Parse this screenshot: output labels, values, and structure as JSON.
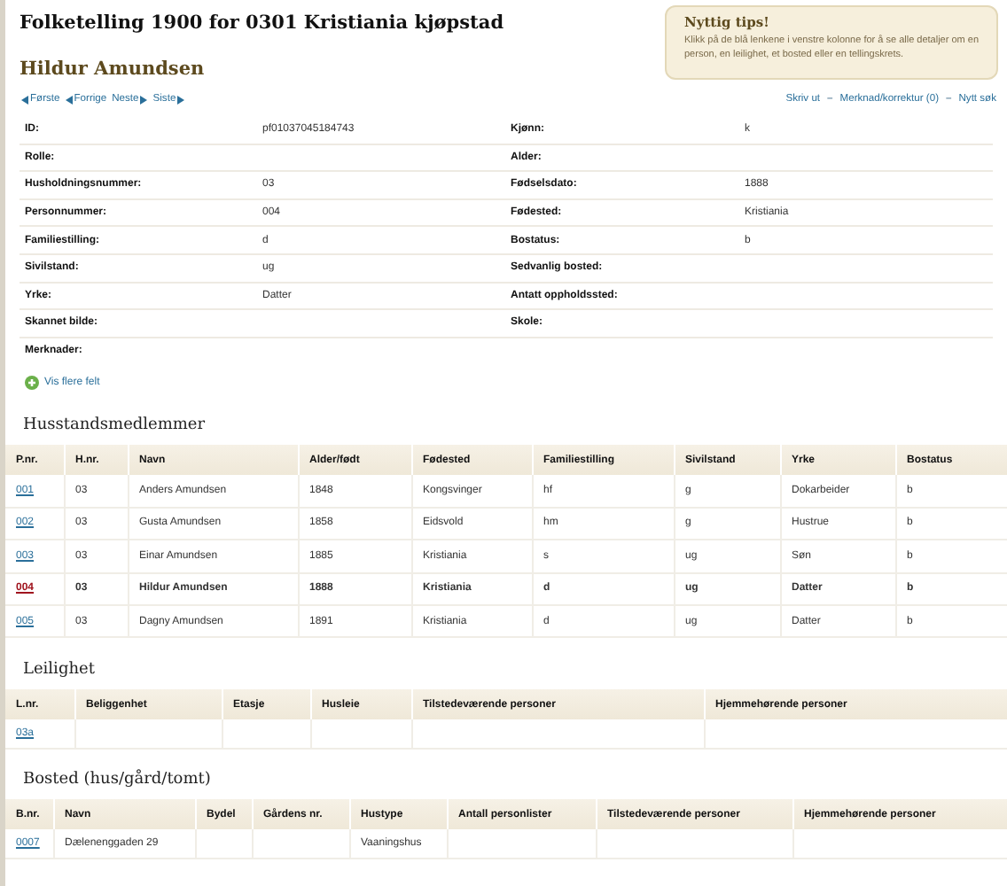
{
  "page_title": "Folketelling 1900 for 0301 Kristiania kjøpstad",
  "person_name": "Hildur Amundsen",
  "tips": {
    "title": "Nyttig tips!",
    "text": "Klikk på de blå lenkene i venstre kolonne for å se alle detaljer om en person, en leilighet, et bosted eller en tellingskrets."
  },
  "nav_links": [
    {
      "label": "Første",
      "kind": "back"
    },
    {
      "label": "Forrige",
      "kind": "back"
    },
    {
      "label": "Neste",
      "kind": "forward"
    },
    {
      "label": "Siste",
      "kind": "forward"
    }
  ],
  "actions": [
    {
      "kind": "link",
      "text": "Skriv ut"
    },
    {
      "kind": "separator",
      "text": "–"
    },
    {
      "kind": "link",
      "text": "Merknad/korrektur (0)"
    },
    {
      "kind": "separator",
      "text": "–"
    },
    {
      "kind": "link",
      "text": "Nytt søk"
    }
  ],
  "details": [
    {
      "label": "ID:",
      "value": "pf01037045184743",
      "label_2": "Kjønn:",
      "value_2": "k"
    },
    {
      "label": "Rolle:",
      "label_2": "Alder:"
    },
    {
      "label": "Husholdningsnummer:",
      "value": "03",
      "label_2": "Fødselsdato:",
      "value_2": "1888"
    },
    {
      "label": "Personnummer:",
      "value": "004",
      "label_2": "Fødested:",
      "value_2": "Kristiania"
    },
    {
      "label": "Familiestilling:",
      "value": "d",
      "label_2": "Bostatus:",
      "value_2": "b"
    },
    {
      "label": "Sivilstand:",
      "value": "ug",
      "label_2": "Sedvanlig bosted:"
    },
    {
      "label": "Yrke:",
      "value": "Datter",
      "label_2": "Antatt oppholdssted:"
    },
    {
      "label": "Skannet bilde:",
      "label_2": "Skole:"
    },
    {
      "label": "Merknader:"
    }
  ],
  "more_fields": "Vis flere felt",
  "household": {
    "title": "Husstandsmedlemmer",
    "columns": [
      "P.nr.",
      "H.nr.",
      "Navn",
      "Alder/født",
      "Fødested",
      "Familiestilling",
      "Sivilstand",
      "Yrke",
      "Bostatus"
    ],
    "rows": [
      {
        "selected": false,
        "cells": [
          "001",
          "03",
          "Anders Amundsen",
          "1848",
          "Kongsvinger",
          "hf",
          "g",
          "Dokarbeider",
          "b"
        ]
      },
      {
        "selected": false,
        "cells": [
          "002",
          "03",
          "Gusta Amundsen",
          "1858",
          "Eidsvold",
          "hm",
          "g",
          "Hustrue",
          "b"
        ]
      },
      {
        "selected": false,
        "cells": [
          "003",
          "03",
          "Einar Amundsen",
          "1885",
          "Kristiania",
          "s",
          "ug",
          "Søn",
          "b"
        ]
      },
      {
        "selected": true,
        "cells": [
          "004",
          "03",
          "Hildur Amundsen",
          "1888",
          "Kristiania",
          "d",
          "ug",
          "Datter",
          "b"
        ]
      },
      {
        "selected": false,
        "cells": [
          "005",
          "03",
          "Dagny Amundsen",
          "1891",
          "Kristiania",
          "d",
          "ug",
          "Datter",
          "b"
        ]
      }
    ]
  },
  "apartment": {
    "title": "Leilighet",
    "columns": [
      "L.nr.",
      "Beliggenhet",
      "Etasje",
      "Husleie",
      "Tilstedeværende personer",
      "Hjemmehørende personer"
    ],
    "rows": [
      {
        "selected": false,
        "cells": [
          "03a",
          "",
          "",
          "",
          "",
          ""
        ]
      }
    ]
  },
  "residence": {
    "title": "Bosted (hus/gård/tomt)",
    "columns": [
      "B.nr.",
      "Navn",
      "Bydel",
      "Gårdens nr.",
      "Hustype",
      "Antall personlister",
      "Tilstedeværende personer",
      "Hjemmehørende personer"
    ],
    "rows": [
      {
        "selected": false,
        "cells": [
          "0007",
          "Dælenenggaden 29",
          "",
          "",
          "Vaaningshus",
          "",
          "",
          ""
        ]
      }
    ]
  }
}
